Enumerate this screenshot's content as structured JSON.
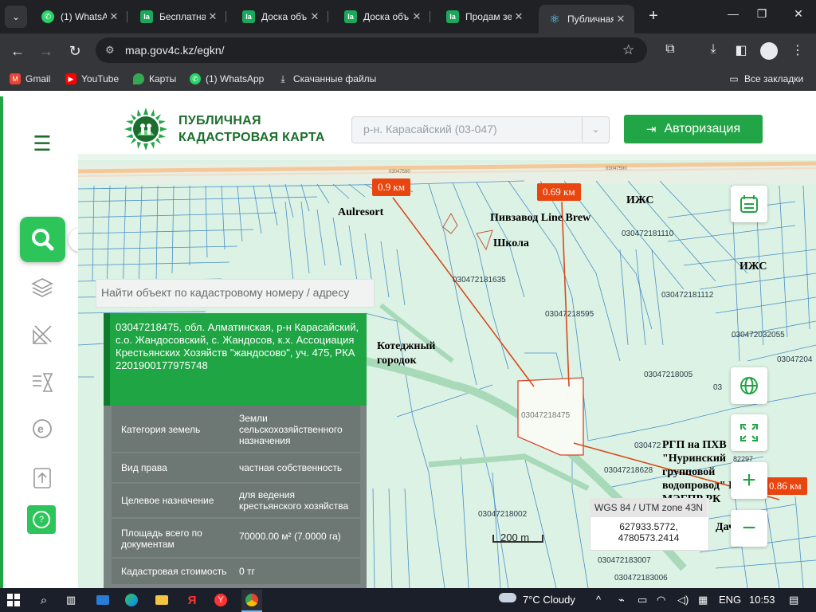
{
  "browser": {
    "tabs": [
      {
        "title": "(1) WhatsA",
        "icon": "whatsapp-icon"
      },
      {
        "title": "Бесплатна",
        "icon": "olx-icon"
      },
      {
        "title": "Доска объ",
        "icon": "olx-icon"
      },
      {
        "title": "Доска объ",
        "icon": "olx-icon"
      },
      {
        "title": "Продам зе",
        "icon": "olx-icon"
      },
      {
        "title": "Публичная",
        "icon": "react-icon",
        "active": true
      }
    ],
    "url": "map.gov4c.kz/egkn/",
    "bookmarks": [
      {
        "label": "Gmail",
        "icon": "gmail-icon",
        "color": "#ea4335"
      },
      {
        "label": "YouTube",
        "icon": "youtube-icon",
        "color": "#ff0000"
      },
      {
        "label": "Карты",
        "icon": "maps-icon",
        "color": "#34a853"
      },
      {
        "label": "(1) WhatsApp",
        "icon": "whatsapp-icon",
        "color": "#25d366"
      },
      {
        "label": "Скачанные файлы",
        "icon": "download-icon",
        "color": "#9aa0a6"
      }
    ],
    "all_bookmarks": "Все закладки"
  },
  "app": {
    "brand_line1": "ПУБЛИЧНАЯ",
    "brand_line2": "КАДАСТРОВАЯ КАРТА",
    "region_value": "р-н. Карасайский (03-047)",
    "auth_label": "Авторизация",
    "search_placeholder": "Найти объект по кадастровому номеру / адресу",
    "accent": "#22a547"
  },
  "info": {
    "header": "03047218475, обл. Алматинская, р-н Карасайский, с.о. Жандосовский, с. Жандосов, к.х. Ассоциация Крестьянских Хозяйств \"жандосово\", уч. 475, РКА 2201900177975748",
    "rows": [
      {
        "key": "Категория земель",
        "value": "Земли сельскохозяйственного назначения"
      },
      {
        "key": "Вид права",
        "value": "частная собственность"
      },
      {
        "key": "Целевое назначение",
        "value": "для ведения крестьянского хозяйства"
      },
      {
        "key": "Площадь всего по документам",
        "value": "70000.00 м² (7.0000 га)"
      },
      {
        "key": "Кадастровая стоимость",
        "value": "0 тг"
      }
    ]
  },
  "map": {
    "distances": [
      "0.9 км",
      "0.69 км",
      "0.86 км"
    ],
    "poi": {
      "aulresort": "Aulresort",
      "pivzavod": "Пивзавод Line Brew",
      "izhs1": "ИЖС",
      "izhs2": "ИЖС",
      "shkola": "Школа",
      "kotedzh": "Котеджный городок",
      "rgp": "РГП на ПХВ \"Нуринский групповой водопровод\" КВР МЭГПР РК",
      "dachi": "Дачи"
    },
    "parcel_labels": {
      "selected": "03047218475",
      "p1": "030472181635",
      "p2": "030472181110",
      "p3": "030472181112",
      "p4": "03047218595",
      "p5": "030472032055",
      "p6": "03047204",
      "p7": "03047218005",
      "p8": "03",
      "p9": "03047218628",
      "p10": "03047218002",
      "p11": "030472183007",
      "p12": "030472183006",
      "p13": "030472",
      "p14": "82297",
      "p15": "03047590",
      "p16": "03047590"
    },
    "scale": "200 m",
    "coords_header": "WGS 84 / UTM zone 43N",
    "coords_x": "627933.5772,",
    "coords_y": "4780573.2414"
  },
  "taskbar": {
    "weather": "7°C  Cloudy",
    "lang": "ENG",
    "time": "10:53"
  }
}
